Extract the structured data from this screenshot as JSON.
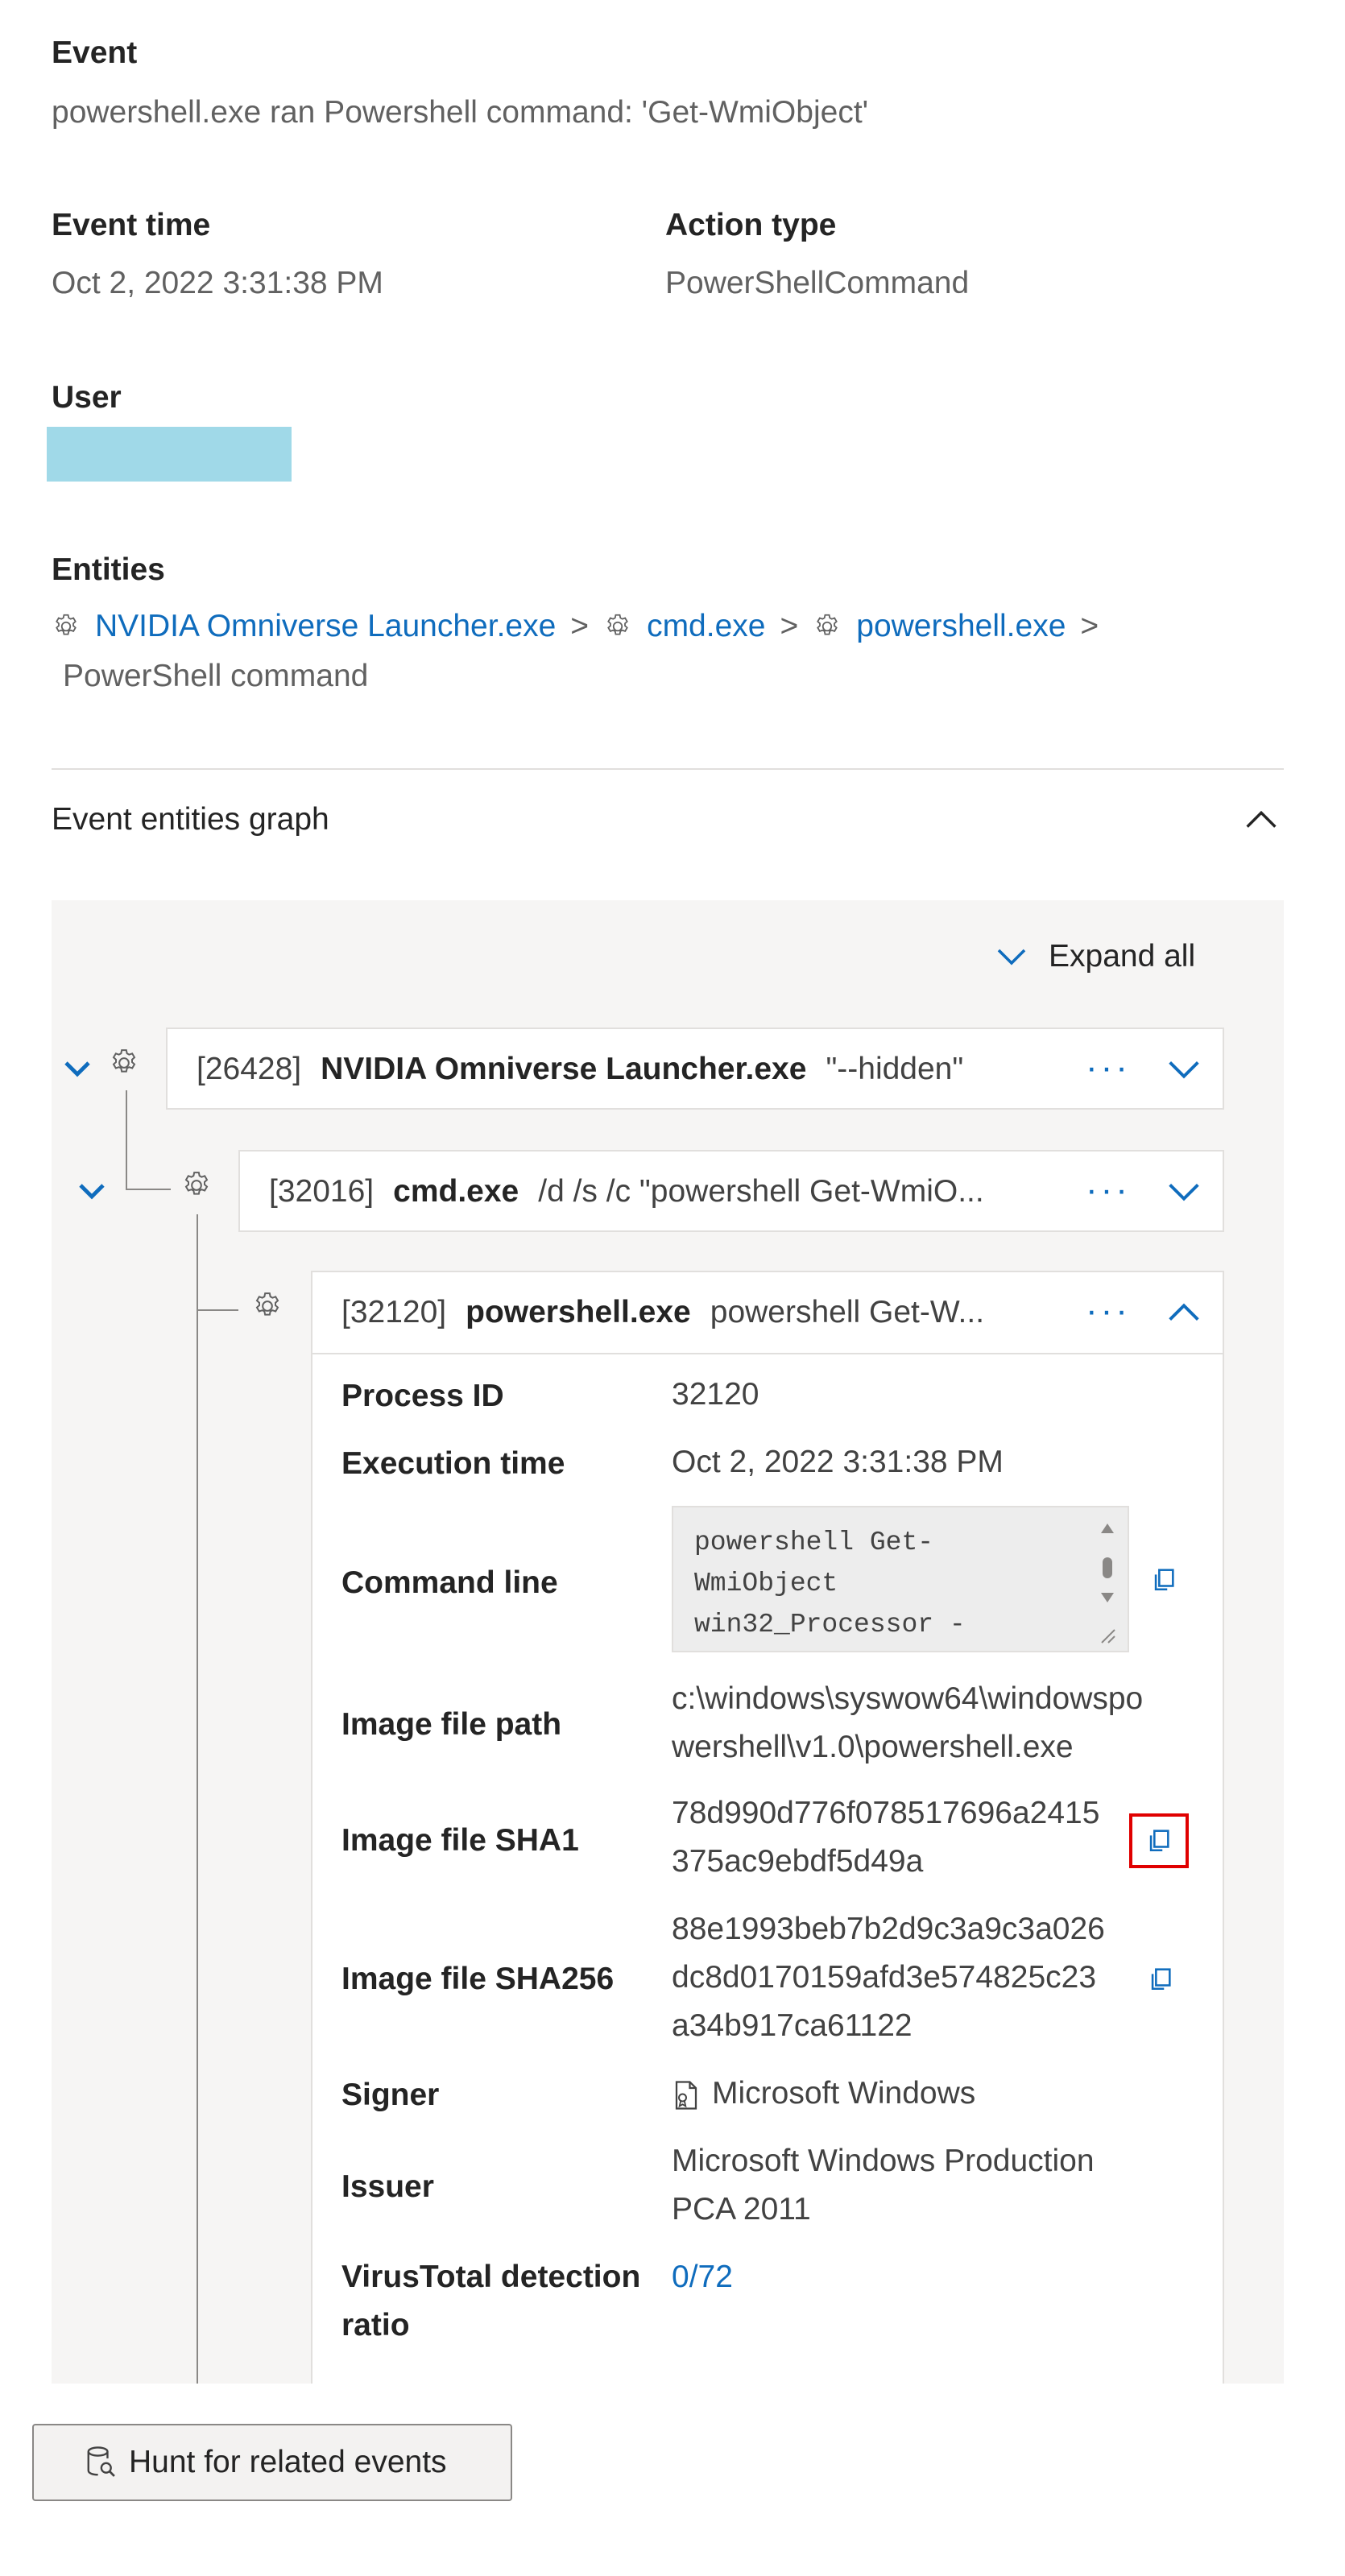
{
  "event": {
    "label": "Event",
    "value": "powershell.exe ran Powershell command: 'Get-WmiObject'"
  },
  "event_time": {
    "label": "Event time",
    "value": "Oct 2, 2022 3:31:38 PM"
  },
  "action_type": {
    "label": "Action type",
    "value": "PowerShellCommand"
  },
  "user": {
    "label": "User",
    "redacted_color": "#a0d9e8"
  },
  "entities": {
    "label": "Entities",
    "chain": [
      "NVIDIA Omniverse Launcher.exe",
      "cmd.exe",
      "powershell.exe"
    ],
    "separator": ">",
    "tail": "PowerShell command"
  },
  "graph": {
    "title": "Event entities graph",
    "expand_all": "Expand all",
    "nodes": [
      {
        "pid": "[26428]",
        "name": "NVIDIA Omniverse Launcher.exe",
        "args": "\"--hidden\""
      },
      {
        "pid": "[32016]",
        "name": "cmd.exe",
        "args": "/d /s /c \"powershell Get-WmiO..."
      },
      {
        "pid": "[32120]",
        "name": "powershell.exe",
        "args": "powershell Get-W..."
      }
    ],
    "more_label": "···",
    "details": {
      "process_id": {
        "label": "Process ID",
        "value": "32120"
      },
      "execution_time": {
        "label": "Execution time",
        "value": "Oct 2, 2022 3:31:38 PM"
      },
      "command_line": {
        "label": "Command line",
        "lines": [
          "powershell  Get-",
          "WmiObject",
          "win32_Processor -"
        ]
      },
      "image_file_path": {
        "label": "Image file path",
        "lines": [
          "c:\\windows\\syswow64\\windowspo",
          "wershell\\v1.0\\powershell.exe"
        ]
      },
      "image_file_sha1": {
        "label": "Image file SHA1",
        "lines": [
          "78d990d776f078517696a2415",
          "375ac9ebdf5d49a"
        ]
      },
      "image_file_sha256": {
        "label": "Image file SHA256",
        "lines": [
          "88e1993beb7b2d9c3a9c3a026",
          "dc8d0170159afd3e574825c23",
          "a34b917ca61122"
        ]
      },
      "signer": {
        "label": "Signer",
        "value": "Microsoft Windows"
      },
      "issuer": {
        "label": "Issuer",
        "lines": [
          "Microsoft Windows Production",
          "PCA 2011"
        ]
      },
      "virustotal": {
        "label_lines": [
          "VirusTotal detection",
          "ratio"
        ],
        "value": "0/72"
      }
    }
  },
  "hunt_button": {
    "label": "Hunt for related events"
  },
  "colors": {
    "accent": "#0f6cbd",
    "highlight": "#e00000"
  }
}
